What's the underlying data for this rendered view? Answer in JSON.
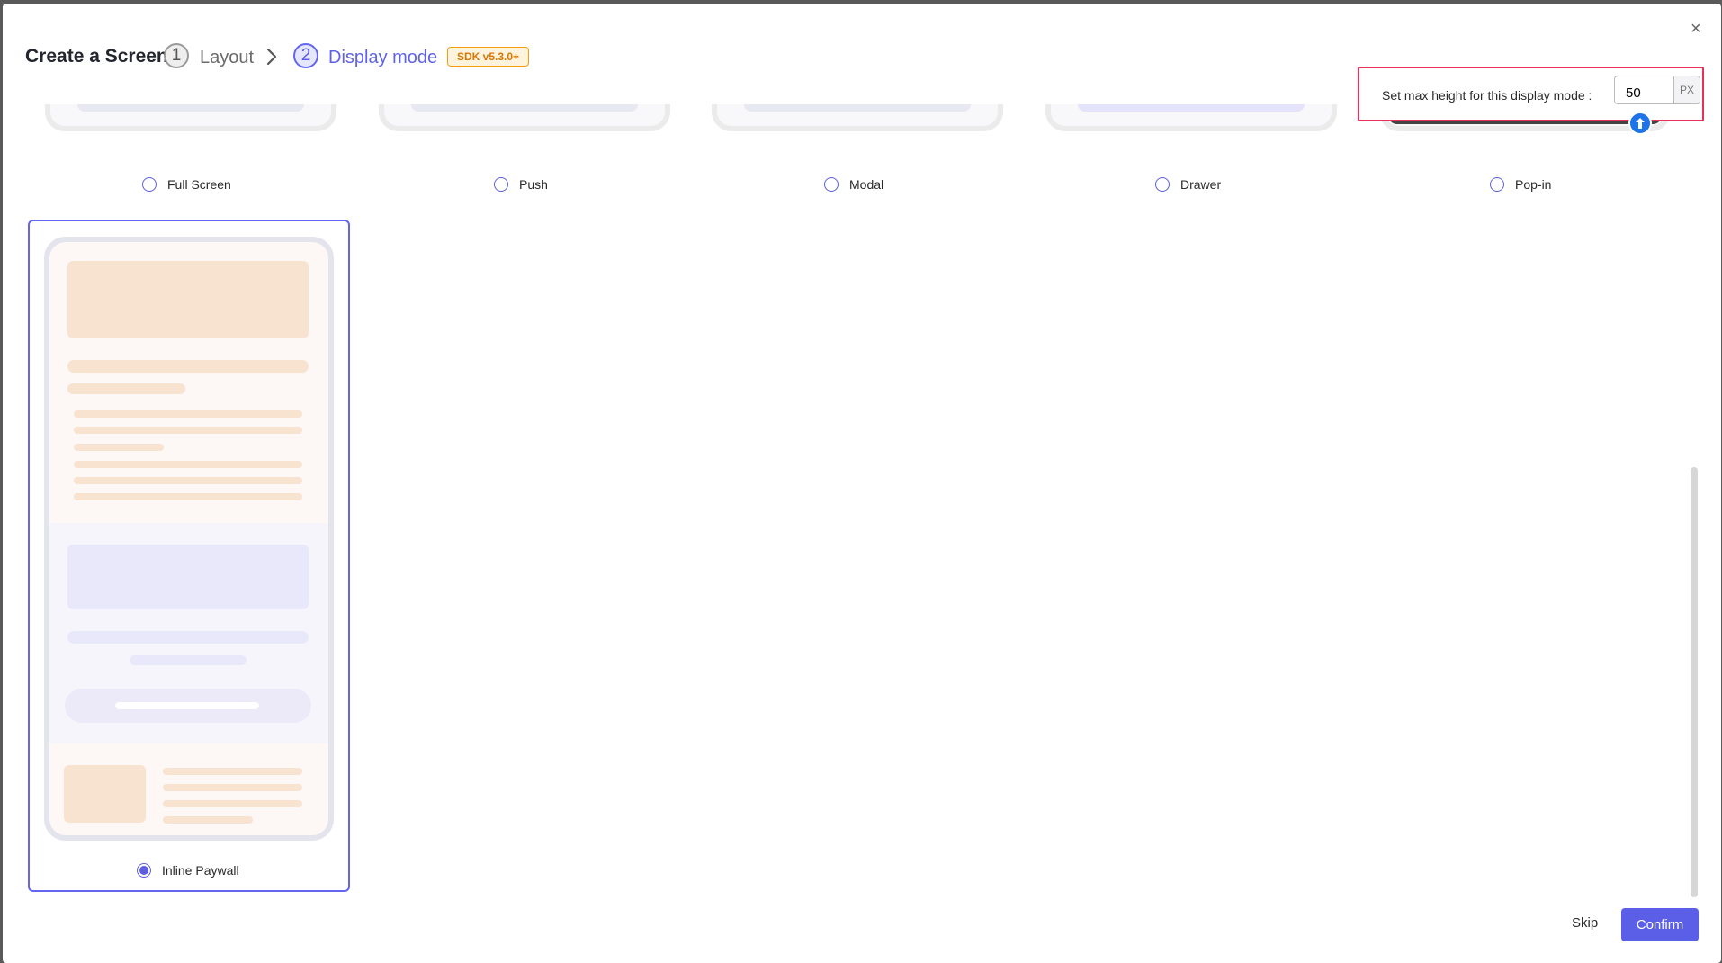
{
  "header": {
    "title": "Create a Screen",
    "step1_number": "1",
    "step1_label": "Layout",
    "step2_number": "2",
    "step2_label": "Display mode",
    "sdk_badge": "SDK v5.3.0+",
    "close_symbol": "×"
  },
  "max_height": {
    "label": "Set max height for this display mode :",
    "value": "50",
    "unit": "PX"
  },
  "display_modes": [
    {
      "label": "Full Screen",
      "selected": false
    },
    {
      "label": "Push",
      "selected": false
    },
    {
      "label": "Modal",
      "selected": false
    },
    {
      "label": "Drawer",
      "selected": false
    },
    {
      "label": "Pop-in",
      "selected": false
    },
    {
      "label": "Inline Paywall",
      "selected": true
    }
  ],
  "footer": {
    "skip_label": "Skip",
    "confirm_label": "Confirm"
  },
  "colors": {
    "accent": "#5b5fe8",
    "highlight_border": "#e8305a",
    "badge_orange": "#d97706",
    "placeholder_peach": "#f7e3cf",
    "placeholder_lavender": "#e9e8fa"
  }
}
